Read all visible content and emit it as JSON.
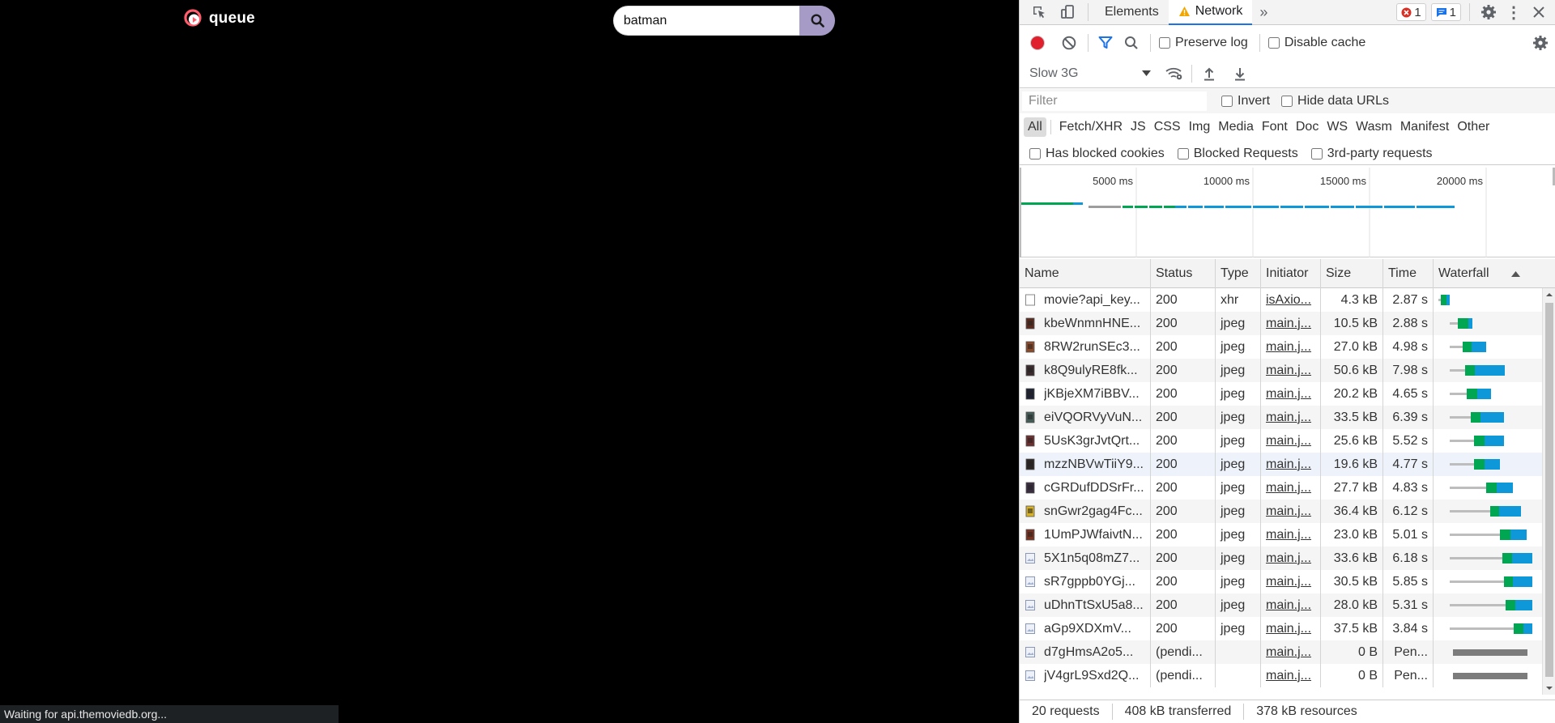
{
  "page": {
    "logo_text": "queue",
    "search_value": "batman",
    "status_text": "Waiting for api.themoviedb.org..."
  },
  "devtools": {
    "tabs": [
      "Elements",
      "Network"
    ],
    "error_count": "1",
    "message_count": "1",
    "preserve_log": "Preserve log",
    "disable_cache": "Disable cache",
    "throttling": "Slow 3G",
    "filter_placeholder": "Filter",
    "invert": "Invert",
    "hide_data_urls": "Hide data URLs",
    "type_filters": [
      "All",
      "Fetch/XHR",
      "JS",
      "CSS",
      "Img",
      "Media",
      "Font",
      "Doc",
      "WS",
      "Wasm",
      "Manifest",
      "Other"
    ],
    "has_blocked_cookies": "Has blocked cookies",
    "blocked_requests": "Blocked Requests",
    "third_party": "3rd-party requests",
    "timeline_ticks": [
      "5000 ms",
      "10000 ms",
      "15000 ms",
      "20000 ms"
    ],
    "columns": [
      "Name",
      "Status",
      "Type",
      "Initiator",
      "Size",
      "Time",
      "Waterfall"
    ],
    "requests": [
      {
        "name": "movie?api_key...",
        "status": "200",
        "type": "xhr",
        "initiator": "isAxio...",
        "size": "4.3 kB",
        "time": "2.87 s",
        "icon": "doc-icon",
        "wf": [
          0.0,
          0.02,
          0.07,
          0.1
        ]
      },
      {
        "name": "kbeWnmnHNE...",
        "status": "200",
        "type": "jpeg",
        "initiator": "main.j...",
        "size": "10.5 kB",
        "time": "2.88 s",
        "icon": "thumb-icon",
        "wf": [
          0.1,
          0.17,
          0.26,
          0.3
        ]
      },
      {
        "name": "8RW2runSEc3...",
        "status": "200",
        "type": "jpeg",
        "initiator": "main.j...",
        "size": "27.0 kB",
        "time": "4.98 s",
        "icon": "thumb-icon",
        "wf": [
          0.1,
          0.21,
          0.29,
          0.42
        ]
      },
      {
        "name": "k8Q9ulyRE8fk...",
        "status": "200",
        "type": "jpeg",
        "initiator": "main.j...",
        "size": "50.6 kB",
        "time": "7.98 s",
        "icon": "thumb-icon",
        "wf": [
          0.1,
          0.23,
          0.32,
          0.58
        ]
      },
      {
        "name": "jKBjeXM7iBBV...",
        "status": "200",
        "type": "jpeg",
        "initiator": "main.j...",
        "size": "20.2 kB",
        "time": "4.65 s",
        "icon": "thumb-icon",
        "wf": [
          0.1,
          0.25,
          0.34,
          0.46
        ]
      },
      {
        "name": "eiVQORVyVuN...",
        "status": "200",
        "type": "jpeg",
        "initiator": "main.j...",
        "size": "33.5 kB",
        "time": "6.39 s",
        "icon": "thumb-icon",
        "wf": [
          0.1,
          0.28,
          0.37,
          0.57
        ]
      },
      {
        "name": "5UsK3grJvtQrt...",
        "status": "200",
        "type": "jpeg",
        "initiator": "main.j...",
        "size": "25.6 kB",
        "time": "5.52 s",
        "icon": "thumb-icon",
        "wf": [
          0.1,
          0.31,
          0.4,
          0.57
        ]
      },
      {
        "name": "mzzNBVwTiiY9...",
        "status": "200",
        "type": "jpeg",
        "initiator": "main.j...",
        "size": "19.6 kB",
        "time": "4.77 s",
        "icon": "thumb-icon",
        "wf": [
          0.1,
          0.31,
          0.4,
          0.54
        ]
      },
      {
        "name": "cGRDufDDSrFr...",
        "status": "200",
        "type": "jpeg",
        "initiator": "main.j...",
        "size": "27.7 kB",
        "time": "4.83 s",
        "icon": "thumb-icon",
        "wf": [
          0.1,
          0.42,
          0.51,
          0.65
        ]
      },
      {
        "name": "snGwr2gag4Fc...",
        "status": "200",
        "type": "jpeg",
        "initiator": "main.j...",
        "size": "36.4 kB",
        "time": "6.12 s",
        "icon": "thumb-icon",
        "wf": [
          0.1,
          0.45,
          0.53,
          0.72
        ]
      },
      {
        "name": "1UmPJWfaivtN...",
        "status": "200",
        "type": "jpeg",
        "initiator": "main.j...",
        "size": "23.0 kB",
        "time": "5.01 s",
        "icon": "thumb-icon",
        "wf": [
          0.1,
          0.54,
          0.63,
          0.77
        ]
      },
      {
        "name": "5X1n5q08mZ7...",
        "status": "200",
        "type": "jpeg",
        "initiator": "main.j...",
        "size": "33.6 kB",
        "time": "6.18 s",
        "icon": "img-icon",
        "wf": [
          0.1,
          0.56,
          0.64,
          0.82
        ]
      },
      {
        "name": "sR7gppb0YGj...",
        "status": "200",
        "type": "jpeg",
        "initiator": "main.j...",
        "size": "30.5 kB",
        "time": "5.85 s",
        "icon": "img-icon",
        "wf": [
          0.1,
          0.57,
          0.65,
          0.82
        ]
      },
      {
        "name": "uDhnTtSxU5a8...",
        "status": "200",
        "type": "jpeg",
        "initiator": "main.j...",
        "size": "28.0 kB",
        "time": "5.31 s",
        "icon": "img-icon",
        "wf": [
          0.1,
          0.59,
          0.67,
          0.82
        ]
      },
      {
        "name": "aGp9XDXmV...",
        "status": "200",
        "type": "jpeg",
        "initiator": "main.j...",
        "size": "37.5 kB",
        "time": "3.84 s",
        "icon": "img-icon",
        "wf": [
          0.1,
          0.66,
          0.74,
          0.82
        ]
      },
      {
        "name": "d7gHmsA2o5...",
        "status": "(pendi...",
        "type": "",
        "initiator": "main.j...",
        "size": "0 B",
        "time": "Pen...",
        "icon": "img-icon",
        "wf": null
      },
      {
        "name": "jV4grL9Sxd2Q...",
        "status": "(pendi...",
        "type": "",
        "initiator": "main.j...",
        "size": "0 B",
        "time": "Pen...",
        "icon": "img-icon",
        "wf": null
      }
    ],
    "summary": {
      "requests": "20 requests",
      "transferred": "408 kB transferred",
      "resources": "378 kB resources"
    },
    "colors": {
      "waiting": "#00a651",
      "download": "#0e98d9",
      "queue": "#bdbdbd",
      "record": "#e0202c",
      "accent": "#1a73e8"
    }
  }
}
